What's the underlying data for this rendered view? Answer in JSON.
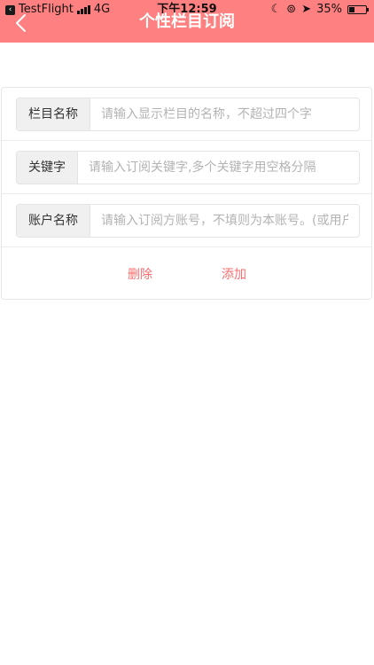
{
  "status_bar": {
    "app_back": "TestFlight",
    "network": "4G",
    "time": "下午12:59",
    "battery": "35%",
    "battery_level": 0.35
  },
  "nav": {
    "title": "个性栏目订阅",
    "back_icon": "chevron-left-icon"
  },
  "form": {
    "fields": [
      {
        "label": "栏目名称",
        "placeholder": "请输入显示栏目的名称，不超过四个字",
        "value": ""
      },
      {
        "label": "关键字",
        "placeholder": "请输入订阅关键字,多个关键字用空格分隔",
        "value": ""
      },
      {
        "label": "账户名称",
        "placeholder": "请输入订阅方账号，不填则为本账号。(或用户名)",
        "value": ""
      }
    ],
    "delete_label": "删除",
    "add_label": "添加"
  },
  "colors": {
    "accent": "#ff8080",
    "action_text": "#ff6b6b"
  }
}
